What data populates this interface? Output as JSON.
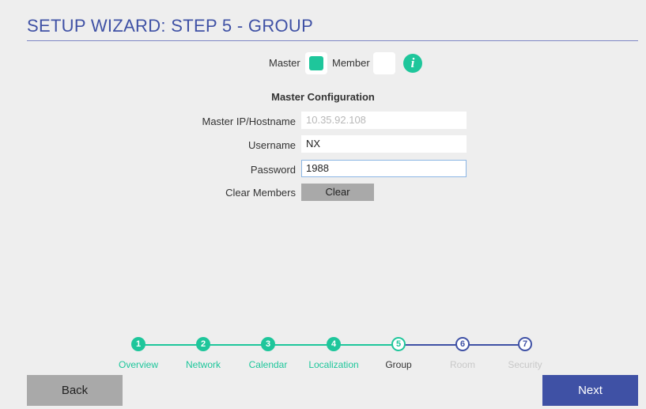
{
  "header": {
    "title": "SETUP WIZARD: STEP 5 - GROUP"
  },
  "mode": {
    "master_label": "Master",
    "member_label": "Member",
    "selected": "Master",
    "info_icon": "i"
  },
  "section": {
    "title": "Master Configuration"
  },
  "form": {
    "master_ip_label": "Master IP/Hostname",
    "master_ip_value": "10.35.92.108",
    "username_label": "Username",
    "username_value": "NX",
    "password_label": "Password",
    "password_value": "1988",
    "clear_members_label": "Clear Members",
    "clear_button": "Clear"
  },
  "steps": [
    {
      "num": "1",
      "label": "Overview",
      "state": "done"
    },
    {
      "num": "2",
      "label": "Network",
      "state": "done"
    },
    {
      "num": "3",
      "label": "Calendar",
      "state": "done"
    },
    {
      "num": "4",
      "label": "Localization",
      "state": "done"
    },
    {
      "num": "5",
      "label": "Group",
      "state": "current"
    },
    {
      "num": "6",
      "label": "Room",
      "state": "future"
    },
    {
      "num": "7",
      "label": "Security",
      "state": "future"
    }
  ],
  "footer": {
    "back": "Back",
    "next": "Next"
  },
  "colors": {
    "accent": "#3f51a5",
    "complete": "#1ec69b",
    "button_gray": "#a9a9a9"
  }
}
